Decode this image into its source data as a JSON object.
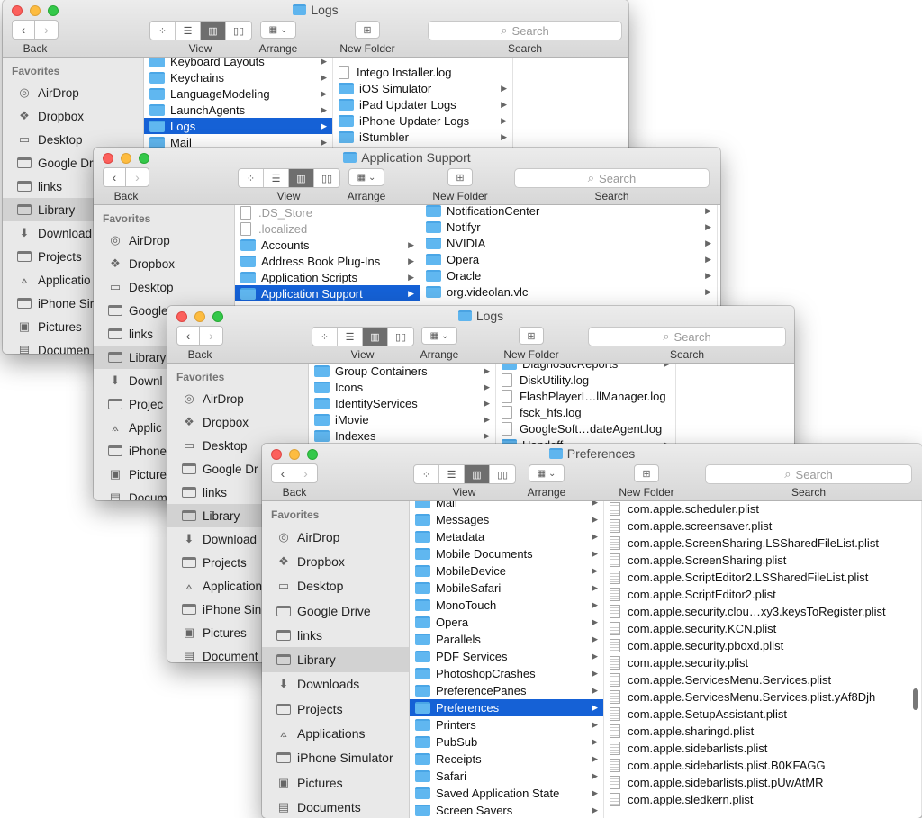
{
  "toolbar": {
    "back": "Back",
    "view": "View",
    "arrange": "Arrange",
    "new_folder": "New Folder",
    "search_label": "Search",
    "search_placeholder": "Search",
    "icons": [
      "chevron-left-icon",
      "chevron-right-icon",
      "icon-view-icon",
      "list-view-icon",
      "column-view-icon",
      "coverflow-view-icon",
      "arrange-grid-icon",
      "new-folder-icon",
      "search-icon"
    ]
  },
  "sidebar": {
    "header": "Favorites",
    "items": [
      "AirDrop",
      "Dropbox",
      "Desktop",
      "Google Drive",
      "links",
      "Library",
      "Downloads",
      "Projects",
      "Applications",
      "iPhone Simulator",
      "Pictures",
      "Documents"
    ],
    "selected": "Library"
  },
  "colors": {
    "selection": "#1561d6",
    "folder": "#60b7f0",
    "close": "#fc605c",
    "minimize": "#fdbc40",
    "zoom": "#34c84a"
  },
  "windows": [
    {
      "title": "Logs",
      "sidebar_labels": [
        "AirDrop",
        "Dropbox",
        "Desktop",
        "Google Dr",
        "links",
        "Library",
        "Download",
        "Projects",
        "Applicatio",
        "iPhone Sir",
        "Pictures",
        "Documen"
      ],
      "col1": [
        "Keyboard Layouts",
        "Keychains",
        "LanguageModeling",
        "LaunchAgents",
        "Logs",
        "Mail"
      ],
      "col1_sel": "Logs",
      "col2": [
        "Intego Installer.log",
        "iOS Simulator",
        "iPad Updater Logs",
        "iPhone Updater Logs",
        "iStumbler"
      ]
    },
    {
      "title": "Application Support",
      "sidebar_labels": [
        "AirDrop",
        "Dropbox",
        "Desktop",
        "Google",
        "links",
        "Library",
        "Downl",
        "Projec",
        "Applic",
        "iPhone",
        "Picture",
        "Docum"
      ],
      "col1": [
        ".DS_Store",
        ".localized",
        "Accounts",
        "Address Book Plug-Ins",
        "Application Scripts",
        "Application Support"
      ],
      "col1_sel": "Application Support",
      "col2": [
        "NotificationCenter",
        "Notifyr",
        "NVIDIA",
        "Opera",
        "Oracle",
        "org.videolan.vlc"
      ]
    },
    {
      "title": "Logs",
      "sidebar_labels": [
        "AirDrop",
        "Dropbox",
        "Desktop",
        "Google Dr",
        "links",
        "Library",
        "Download",
        "Projects",
        "Application",
        "iPhone Sin",
        "Pictures",
        "Document"
      ],
      "col1": [
        "Group Containers",
        "Icons",
        "IdentityServices",
        "iMovie",
        "Indexes"
      ],
      "col2": [
        "DiagnosticReports",
        "DiskUtility.log",
        "FlashPlayerI…llManager.log",
        "fsck_hfs.log",
        "GoogleSoft…dateAgent.log",
        "Handoff"
      ]
    },
    {
      "title": "Preferences",
      "sidebar_labels": [
        "AirDrop",
        "Dropbox",
        "Desktop",
        "Google Drive",
        "links",
        "Library",
        "Downloads",
        "Projects",
        "Applications",
        "iPhone Simulator",
        "Pictures",
        "Documents"
      ],
      "col1": [
        "Mail",
        "Messages",
        "Metadata",
        "Mobile Documents",
        "MobileDevice",
        "MobileSafari",
        "MonoTouch",
        "Opera",
        "Parallels",
        "PDF Services",
        "PhotoshopCrashes",
        "PreferencePanes",
        "Preferences",
        "Printers",
        "PubSub",
        "Receipts",
        "Safari",
        "Saved Application State",
        "Screen Savers"
      ],
      "col1_sel": "Preferences",
      "col2": [
        "com.apple.scheduler.plist",
        "com.apple.screensaver.plist",
        "com.apple.ScreenSharing.LSSharedFileList.plist",
        "com.apple.ScreenSharing.plist",
        "com.apple.ScriptEditor2.LSSharedFileList.plist",
        "com.apple.ScriptEditor2.plist",
        "com.apple.security.clou…xy3.keysToRegister.plist",
        "com.apple.security.KCN.plist",
        "com.apple.security.pboxd.plist",
        "com.apple.security.plist",
        "com.apple.ServicesMenu.Services.plist",
        "com.apple.ServicesMenu.Services.plist.yAf8Djh",
        "com.apple.SetupAssistant.plist",
        "com.apple.sharingd.plist",
        "com.apple.sidebarlists.plist",
        "com.apple.sidebarlists.plist.B0KFAGG",
        "com.apple.sidebarlists.plist.pUwAtMR",
        "com.apple.sledkern.plist"
      ]
    }
  ]
}
